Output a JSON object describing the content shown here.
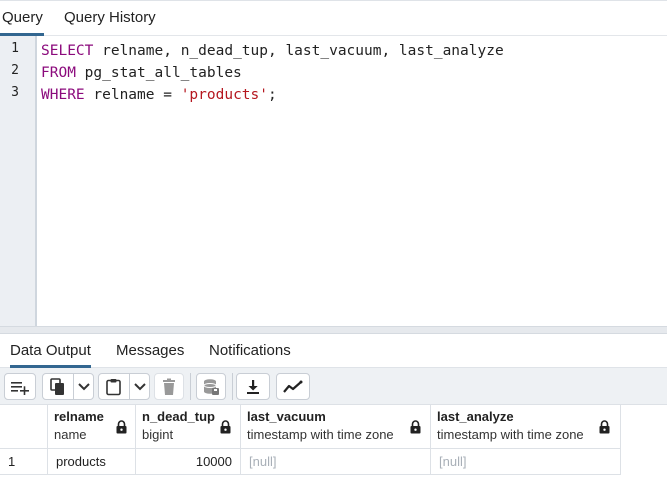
{
  "query_tabs": [
    {
      "label": "Query",
      "active": true
    },
    {
      "label": "Query History",
      "active": false
    }
  ],
  "editor": {
    "line_numbers": [
      "1",
      "2",
      "3"
    ],
    "lines": [
      [
        {
          "t": "kw",
          "v": "SELECT"
        },
        {
          "t": "plain",
          "v": " relname, n_dead_tup, last_vacuum, last_analyze"
        }
      ],
      [
        {
          "t": "kw",
          "v": "FROM"
        },
        {
          "t": "plain",
          "v": " pg_stat_all_tables"
        }
      ],
      [
        {
          "t": "kw",
          "v": "WHERE"
        },
        {
          "t": "plain",
          "v": " relname = "
        },
        {
          "t": "str",
          "v": "'products'"
        },
        {
          "t": "plain",
          "v": ";"
        }
      ]
    ]
  },
  "result_tabs": [
    {
      "label": "Data Output",
      "active": true
    },
    {
      "label": "Messages",
      "active": false
    },
    {
      "label": "Notifications",
      "active": false
    }
  ],
  "toolbar": {
    "icons": [
      "add-row-icon",
      "copy-icon",
      "chevron-down-icon",
      "paste-icon",
      "chevron-down-icon",
      "delete-icon",
      "save-data-icon",
      "download-icon",
      "graph-icon"
    ]
  },
  "grid": {
    "columns": [
      {
        "name": "relname",
        "type": "name"
      },
      {
        "name": "n_dead_tup",
        "type": "bigint"
      },
      {
        "name": "last_vacuum",
        "type": "timestamp with time zone"
      },
      {
        "name": "last_analyze",
        "type": "timestamp with time zone"
      }
    ],
    "rows": [
      {
        "num": "1",
        "cells": [
          "products",
          "10000",
          "[null]",
          "[null]"
        ]
      }
    ]
  },
  "colors": {
    "keyword": "#8b0a7c",
    "string": "#b5171f",
    "active_tab_underline": "#326690",
    "null_text": "#a9b0b8"
  }
}
